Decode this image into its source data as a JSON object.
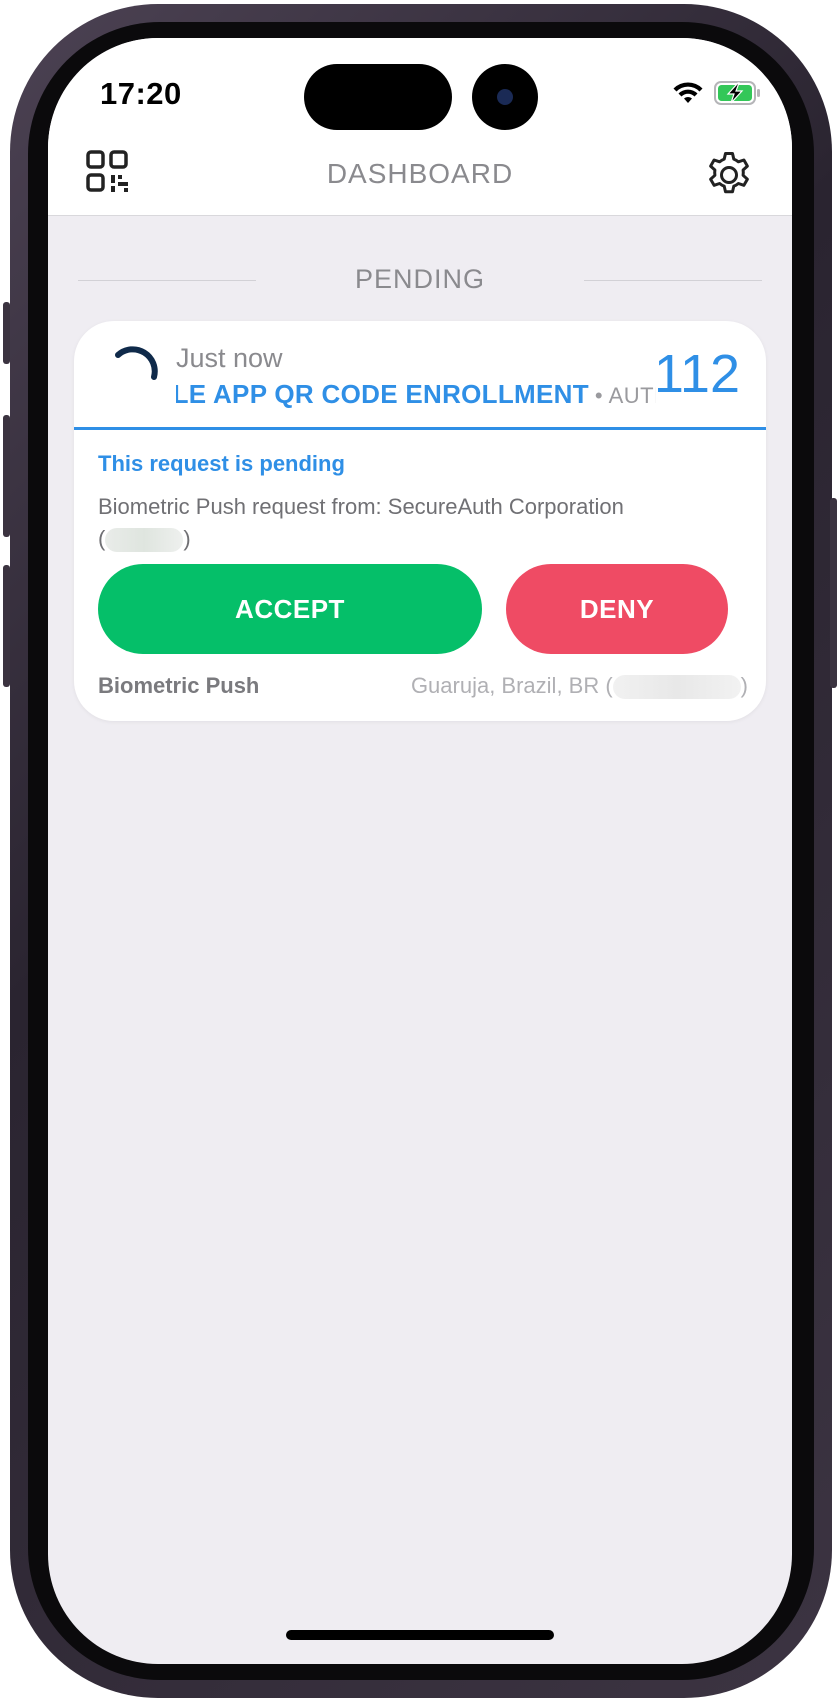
{
  "status_bar": {
    "time": "17:20",
    "icons": [
      "wifi-icon",
      "battery-charging-icon"
    ],
    "battery_color": "#33c758"
  },
  "header": {
    "title": "DASHBOARD",
    "left_icon": "qr-code-icon",
    "right_icon": "gear-icon"
  },
  "section": {
    "label": "PENDING"
  },
  "request_card": {
    "time": "Just now",
    "app_name": "BILE APP QR CODE ENROLLMENT",
    "separator": "•",
    "org_abbrev": "AUTH",
    "code": "112",
    "status_message": "This request is pending",
    "description": "Biometric Push request from: SecureAuth Corporation",
    "accept_label": "ACCEPT",
    "deny_label": "DENY",
    "method": "Biometric Push",
    "location": "Guaruja, Brazil, BR ("
  },
  "colors": {
    "accent": "#2f8fe6",
    "accept": "#05bf69",
    "deny": "#ef4b64",
    "background": "#efedf2"
  }
}
